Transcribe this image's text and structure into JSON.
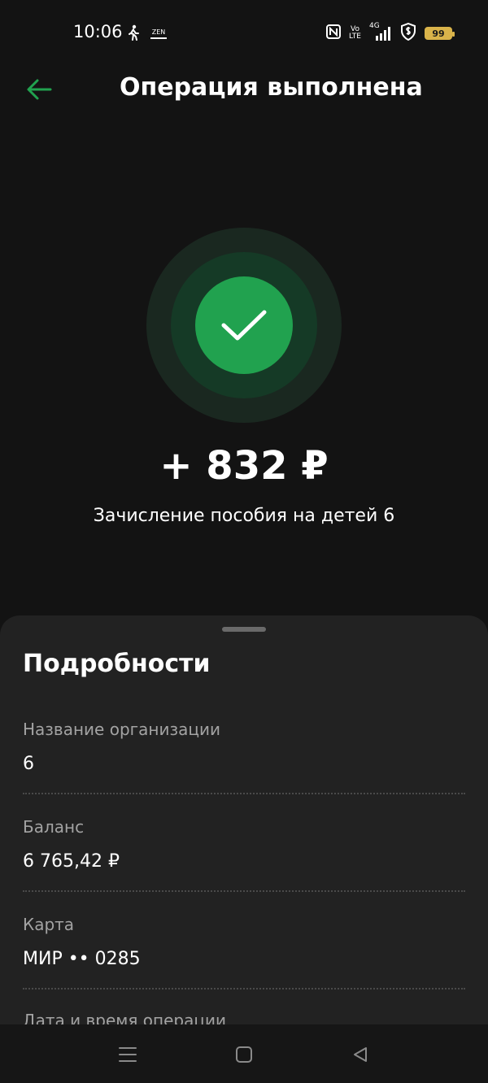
{
  "status_bar": {
    "time": "10:06",
    "icons_left": [
      "walking-icon",
      "zen-icon"
    ],
    "zen_label": "ZEN",
    "icons_right": [
      "nfc-icon",
      "volte-icon",
      "signal-4g-icon",
      "shield-dollar-icon",
      "battery-icon"
    ],
    "volte_top": "Vo",
    "volte_bottom": "LTE",
    "network_label": "4G",
    "battery_level": "99",
    "battery_color": "#d9b34a"
  },
  "header": {
    "title": "Операция выполнена",
    "back_icon": "arrow-left-icon",
    "accent_color": "#21a24f"
  },
  "result": {
    "status_icon": "checkmark-icon",
    "amount": "+ 832 ₽",
    "description": "Зачисление пособия на детей 6"
  },
  "details": {
    "title": "Подробности",
    "items": [
      {
        "label": "Название организации",
        "value": "6"
      },
      {
        "label": "Баланс",
        "value": "6 765,42 ₽"
      },
      {
        "label": "Карта",
        "value": "МИР •• 0285"
      }
    ],
    "partial_label": "Дата и время операции"
  },
  "nav_bar": {
    "buttons": [
      "menu-icon",
      "home-icon",
      "back-triangle-icon"
    ]
  }
}
